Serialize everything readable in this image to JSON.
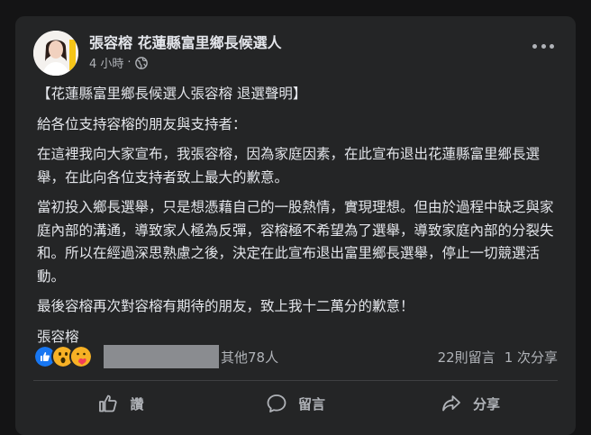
{
  "post": {
    "author": "張容榕 花蓮縣富里鄉長候選人",
    "time": "4 小時",
    "dot": "·",
    "paragraphs": [
      "【花蓮縣富里鄉長候選人張容榕  退選聲明】",
      "給各位支持容榕的朋友與支持者：",
      "在這裡我向大家宣布，我張容榕，因為家庭因素，在此宣布退出花蓮縣富里鄉長選舉，在此向各位支持者致上最大的歉意。",
      "當初投入鄉長選舉，只是想憑藉自己的一股熱情，實現理想。但由於過程中缺乏與家庭內部的溝通，導致家人極為反彈，容榕極不希望為了選舉，導致家庭內部的分裂失和。所以在經過深思熟慮之後，決定在此宣布退出富里鄉長選舉，停止一切競選活動。",
      "最後容榕再次對容榕有期待的朋友，致上我十二萬分的歉意！",
      "張容榕"
    ]
  },
  "stats": {
    "others": "其他78人",
    "comments": "22則留言",
    "shares": "1 次分享"
  },
  "actions": {
    "like": "讚",
    "comment": "留言",
    "share": "分享"
  },
  "colors": {
    "background": "#141415",
    "card": "#242526",
    "text": "#e4e6eb",
    "muted": "#b0b3b8",
    "like_blue": "#1877f2",
    "wow_yellow": "#f7b125",
    "care_red": "#f33e58"
  },
  "icons": {
    "globe": "globe-icon",
    "more": "more-options-icon",
    "like": "thumbs-up-icon",
    "comment": "comment-bubble-icon",
    "share": "share-arrow-icon"
  }
}
